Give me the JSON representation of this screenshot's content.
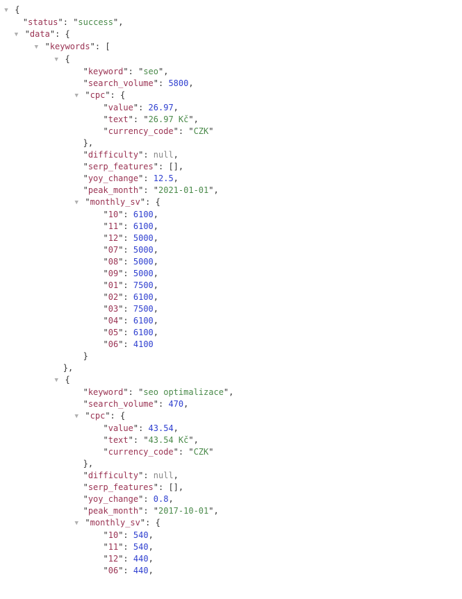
{
  "status_key": "status",
  "status_val": "success",
  "data_key": "data",
  "keywords_key": "keywords",
  "kw_key": "keyword",
  "sv_key": "search_volume",
  "cpc_key": "cpc",
  "value_key": "value",
  "text_key": "text",
  "cc_key": "currency_code",
  "diff_key": "difficulty",
  "serp_key": "serp_features",
  "yoy_key": "yoy_change",
  "peak_key": "peak_month",
  "msv_key": "monthly_sv",
  "diff_val": "null",
  "serp_val": "[]",
  "k1": {
    "keyword": "seo",
    "search_volume": "5800",
    "cpc_value": "26.97",
    "cpc_text": "26.97 Kč",
    "cpc_cc": "CZK",
    "yoy": "12.5",
    "peak": "2021-01-01",
    "m10k": "10",
    "m10v": "6100",
    "m11k": "11",
    "m11v": "6100",
    "m12k": "12",
    "m12v": "5000",
    "m07k": "07",
    "m07v": "5000",
    "m08k": "08",
    "m08v": "5000",
    "m09k": "09",
    "m09v": "5000",
    "m01k": "01",
    "m01v": "7500",
    "m02k": "02",
    "m02v": "6100",
    "m03k": "03",
    "m03v": "7500",
    "m04k": "04",
    "m04v": "6100",
    "m05k": "05",
    "m05v": "6100",
    "m06k": "06",
    "m06v": "4100"
  },
  "k2": {
    "keyword": "seo optimalizace",
    "search_volume": "470",
    "cpc_value": "43.54",
    "cpc_text": "43.54 Kč",
    "cpc_cc": "CZK",
    "yoy": "0.8",
    "peak": "2017-10-01",
    "m10k": "10",
    "m10v": "540",
    "m11k": "11",
    "m11v": "540",
    "m12k": "12",
    "m12v": "440",
    "m06k": "06",
    "m06v": "440"
  }
}
